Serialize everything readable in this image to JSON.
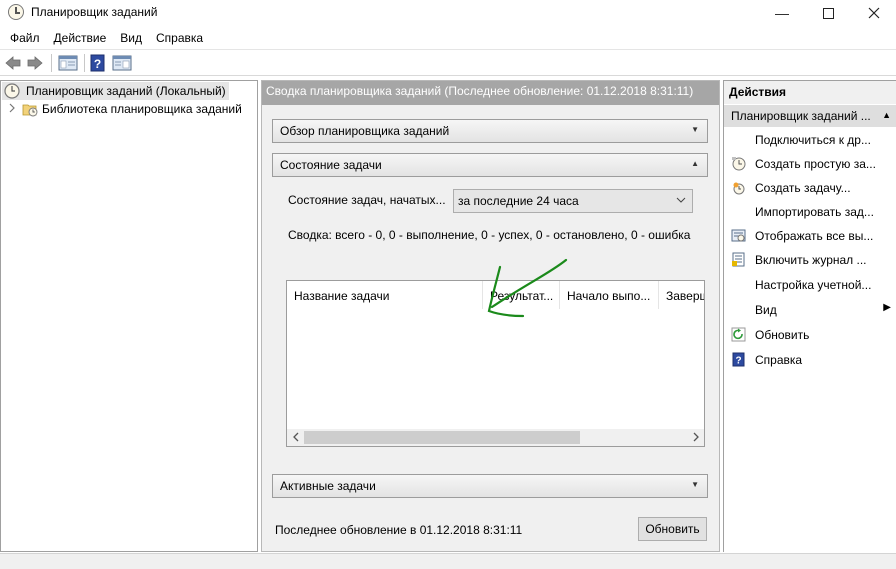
{
  "window": {
    "title": "Планировщик заданий",
    "minimize_glyph": "—",
    "maximize_glyph": "☐",
    "close_glyph": "✕"
  },
  "menu": [
    "Файл",
    "Действие",
    "Вид",
    "Справка"
  ],
  "toolbar": {
    "icons": [
      "back-arrow-icon",
      "forward-arrow-icon",
      "show-hide-console-tree-icon",
      "help-icon",
      "show-hide-action-pane-icon"
    ]
  },
  "tree": {
    "root_label": "Планировщик заданий (Локальный)",
    "child_label": "Библиотека планировщика заданий"
  },
  "center": {
    "header": "Сводка планировщика заданий (Последнее обновление: 01.12.2018 8:31:11)",
    "overview_section": "Обзор планировщика заданий",
    "status_section": "Состояние задачи",
    "status_label": "Состояние задач, начатых...",
    "status_combo_value": "за последние 24 часа",
    "summary": "Сводка: всего - 0, 0 - выполнение, 0 - успех, 0 - остановлено, 0 - ошибка",
    "grid_columns": [
      "Название задачи",
      "Результат...",
      "Начало выпо...",
      "Заверш"
    ],
    "active_section": "Активные задачи",
    "footer_text": "Последнее обновление в 01.12.2018 8:31:11",
    "refresh_button": "Обновить"
  },
  "actions": {
    "title": "Действия",
    "group": "Планировщик заданий ...",
    "items": [
      {
        "label": "Подключиться к др...",
        "icon": "none"
      },
      {
        "label": "Создать простую за...",
        "icon": "create-basic-task-icon"
      },
      {
        "label": "Создать задачу...",
        "icon": "create-task-icon"
      },
      {
        "label": "Импортировать зад...",
        "icon": "none"
      },
      {
        "label": "Отображать все вы...",
        "icon": "display-running-tasks-icon"
      },
      {
        "label": "Включить журнал ...",
        "icon": "enable-log-icon"
      },
      {
        "label": "Настройка учетной...",
        "icon": "none"
      },
      {
        "label": "Вид",
        "icon": "none"
      },
      {
        "label": "Обновить",
        "icon": "refresh-icon"
      },
      {
        "label": "Справка",
        "icon": "help-icon"
      }
    ]
  },
  "colors": {
    "center_header_bg": "#a6a6a6",
    "selection_bg": "#e5e5e5",
    "annotation_arrow": "#1b8a1b"
  }
}
